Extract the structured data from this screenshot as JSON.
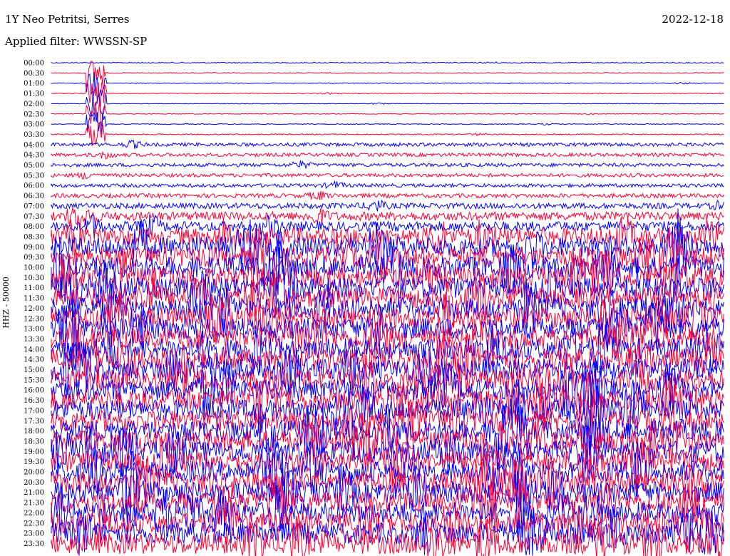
{
  "header": {
    "station": "1Y Neo Petritsi, Serres",
    "date": "2022-12-18",
    "filter_label": "Applied filter: WWSSN-SP"
  },
  "chart_data": {
    "type": "line",
    "title": "1Y Neo Petritsi, Serres",
    "subtitle": "Applied filter: WWSSN-SP",
    "ylabel": "HHZ - 50000",
    "row_labels": [
      "00:00",
      "00:30",
      "01:00",
      "01:30",
      "02:00",
      "02:30",
      "03:00",
      "03:30",
      "04:00",
      "04:30",
      "05:00",
      "05:30",
      "06:00",
      "06:30",
      "07:00",
      "07:30",
      "08:00",
      "08:30",
      "09:00",
      "09:30",
      "10:00",
      "10:30",
      "11:00",
      "11:30",
      "12:00",
      "12:30",
      "13:00",
      "13:30",
      "14:00",
      "14:30",
      "15:00",
      "15:30",
      "16:00",
      "16:30",
      "17:00",
      "17:30",
      "18:00",
      "18:30",
      "19:00",
      "19:30",
      "20:00",
      "20:30",
      "21:00",
      "21:30",
      "22:00",
      "22:30",
      "23:00",
      "23:30"
    ],
    "series_colors": [
      "#0000ff",
      "#ff0033"
    ],
    "relative_noise_amplitude": [
      0.6,
      0.6,
      0.6,
      0.5,
      0.5,
      0.5,
      0.6,
      0.8,
      2.5,
      2.5,
      2.5,
      2.5,
      2.5,
      3,
      4,
      6,
      7,
      12,
      14,
      14,
      15,
      15,
      15,
      15,
      15,
      15,
      15,
      15,
      15,
      15,
      15,
      15,
      15,
      15,
      15,
      15,
      15,
      15,
      15,
      15,
      15,
      15,
      15,
      15,
      15,
      15,
      15,
      15
    ],
    "grid": false
  }
}
